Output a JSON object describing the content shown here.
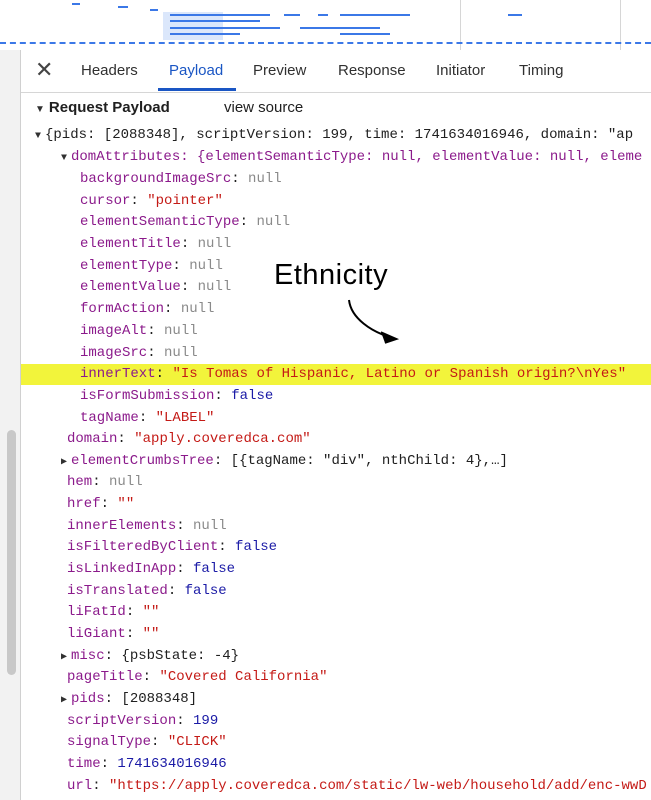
{
  "tabs": {
    "close_icon": "close-icon",
    "items": [
      "Headers",
      "Payload",
      "Preview",
      "Response",
      "Initiator",
      "Timing"
    ],
    "active": "Payload"
  },
  "payload": {
    "title": "Request Payload",
    "view_source": "view source",
    "root_line": "{pids: [2088348], scriptVersion: 199, time: 1741634016946, domain: \"ap",
    "dom_attributes_line": "domAttributes: {elementSemanticType: null, elementValue: null, eleme",
    "dom_attributes": {
      "backgroundImageSrc": "null",
      "cursor": "\"pointer\"",
      "elementSemanticType": "null",
      "elementTitle": "null",
      "elementType": "null",
      "elementValue": "null",
      "formAction": "null",
      "imageAlt": "null",
      "imageSrc": "null",
      "innerText": "\"Is Tomas of Hispanic, Latino or Spanish origin?\\nYes\"",
      "isFormSubmission": "false",
      "tagName": "\"LABEL\""
    },
    "fields": {
      "domain": "\"apply.coveredca.com\"",
      "elementCrumbsTree": "[{tagName: \"div\", nthChild: 4},…]",
      "hem": "null",
      "href": "\"\"",
      "innerElements": "null",
      "isFilteredByClient": "false",
      "isLinkedInApp": "false",
      "isTranslated": "false",
      "liFatId": "\"\"",
      "liGiant": "\"\"",
      "misc": "{psbState: -4}",
      "pageTitle": "\"Covered California\"",
      "pids": "[2088348]",
      "scriptVersion": "199",
      "signalType": "\"CLICK\"",
      "time": "1741634016946",
      "url": "\"https://apply.coveredca.com/static/lw-web/household/add/enc-wwD"
    }
  },
  "annotation": {
    "text": "Ethnicity"
  },
  "colors": {
    "key": "#8b1a8b",
    "string": "#c41a16",
    "number": "#1a1aa6",
    "null": "#8a8a8a",
    "highlight": "#f2f43b",
    "accent": "#1a56c4"
  }
}
